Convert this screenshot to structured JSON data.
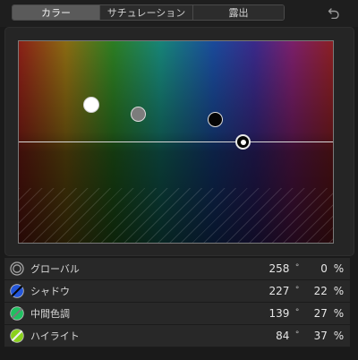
{
  "tabs": [
    {
      "label": "カラー"
    },
    {
      "label": "サチュレーション"
    },
    {
      "label": "露出"
    }
  ],
  "active_tab": "カラー",
  "undo_icon": "undo-icon",
  "board": {
    "pucks": [
      "global-puck",
      "midtones-puck",
      "shadows-puck",
      "highlights-puck"
    ]
  },
  "rows": [
    {
      "label": "グローバル",
      "angle": "258",
      "deg": "°",
      "value": "0",
      "percent": "%",
      "swatch": "#4a4a4a",
      "icon": "global-swatch-icon"
    },
    {
      "label": "シャドウ",
      "angle": "227",
      "deg": "°",
      "value": "22",
      "percent": "%",
      "swatch": "#2456d8",
      "icon": "shadows-swatch-icon"
    },
    {
      "label": "中間色調",
      "angle": "139",
      "deg": "°",
      "value": "27",
      "percent": "%",
      "swatch": "#1fc060",
      "icon": "midtones-swatch-icon"
    },
    {
      "label": "ハイライト",
      "angle": "84",
      "deg": "°",
      "value": "37",
      "percent": "%",
      "swatch": "#8ad11c",
      "icon": "highlights-swatch-icon"
    }
  ]
}
